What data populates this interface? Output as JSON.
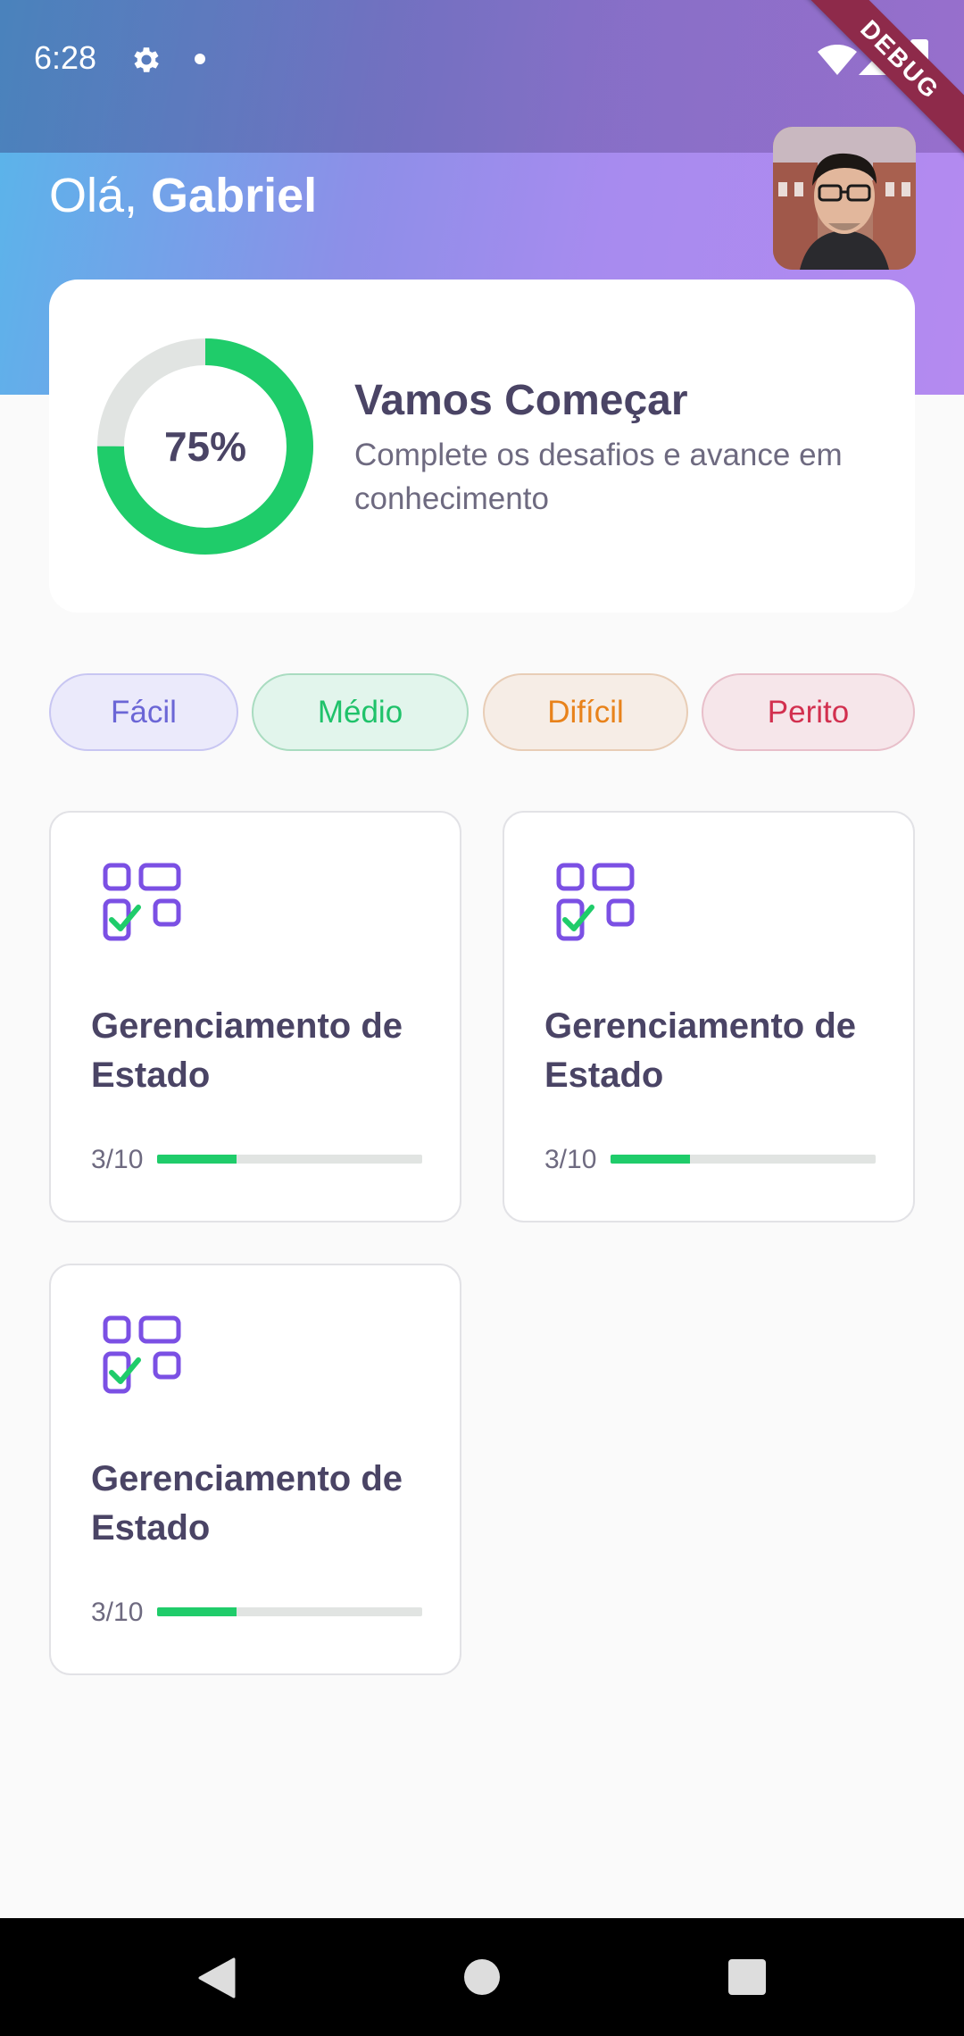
{
  "status_bar": {
    "time": "6:28",
    "icons": [
      "gear-icon",
      "notification-dot-icon",
      "wifi-icon",
      "cell-signal-icon",
      "battery-icon"
    ]
  },
  "debug_banner": "DEBUG",
  "header": {
    "greeting_prefix": "Olá, ",
    "user_name": "Gabriel"
  },
  "progress_card": {
    "percent": 75,
    "percent_label": "75%",
    "title": "Vamos Começar",
    "subtitle": "Complete os desafios e avance em conhecimento"
  },
  "filters": [
    {
      "label": "Fácil"
    },
    {
      "label": "Médio"
    },
    {
      "label": "Difícil"
    },
    {
      "label": "Perito"
    }
  ],
  "topics": [
    {
      "title": "Gerenciamento de Estado",
      "count_label": "3/10",
      "progress": 0.3,
      "icon": "checklist-grid-icon"
    },
    {
      "title": "Gerenciamento de Estado",
      "count_label": "3/10",
      "progress": 0.3,
      "icon": "checklist-grid-icon"
    },
    {
      "title": "Gerenciamento de Estado",
      "count_label": "3/10",
      "progress": 0.3,
      "icon": "checklist-grid-icon"
    }
  ],
  "colors": {
    "accent_green": "#1fcc6a",
    "text_dark": "#4a4465",
    "icon_purple": "#7b50e4",
    "chip_facil": "#6b66d6",
    "chip_medio": "#1fc26a",
    "chip_dificil": "#e8821a",
    "chip_perito": "#d2304f"
  }
}
